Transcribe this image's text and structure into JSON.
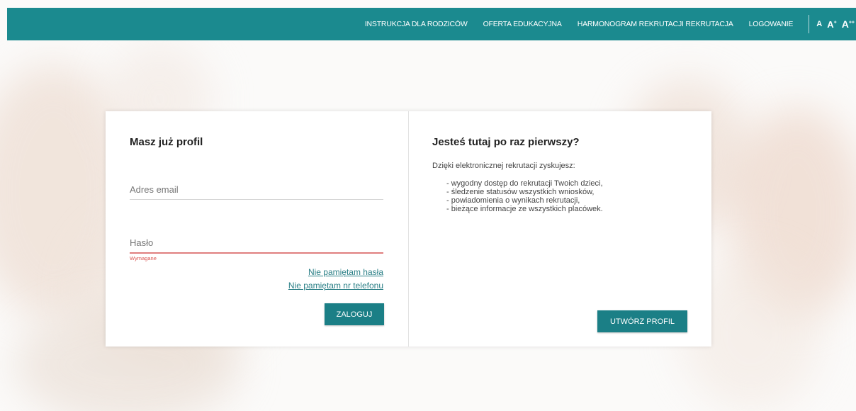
{
  "nav": {
    "items": [
      "INSTRUKCJA DLA RODZICÓW",
      "OFERTA EDUKACYJNA",
      "HARMONOGRAM REKRUTACJI REKRUTACJA",
      "LOGOWANIE"
    ],
    "font_sizes": [
      "A",
      "A",
      "A"
    ],
    "font_size_suffixes": [
      "",
      "+",
      "++"
    ]
  },
  "login": {
    "title": "Masz już profil",
    "email_placeholder": "Adres email",
    "password_placeholder": "Hasło",
    "password_error": "Wymagane",
    "forgot_password": "Nie pamiętam hasła",
    "forgot_phone": "Nie pamiętam nr telefonu",
    "submit_label": "ZALOGUJ"
  },
  "register": {
    "title": "Jesteś tutaj po raz pierwszy?",
    "intro": "Dzięki elektronicznej rekrutacji zyskujesz:",
    "benefits": [
      "wygodny dostęp do rekrutacji Twoich dzieci,",
      "śledzenie statusów wszystkich wniosków,",
      "powiadomienia o wynikach rekrutacji,",
      "bieżące informacje ze wszystkich placówek."
    ],
    "create_label": "UTWÓRZ PROFIL"
  },
  "colors": {
    "accent": "#1b8a8f",
    "button": "#1b7f86",
    "error": "#d9534f",
    "link": "#2a7f86"
  }
}
